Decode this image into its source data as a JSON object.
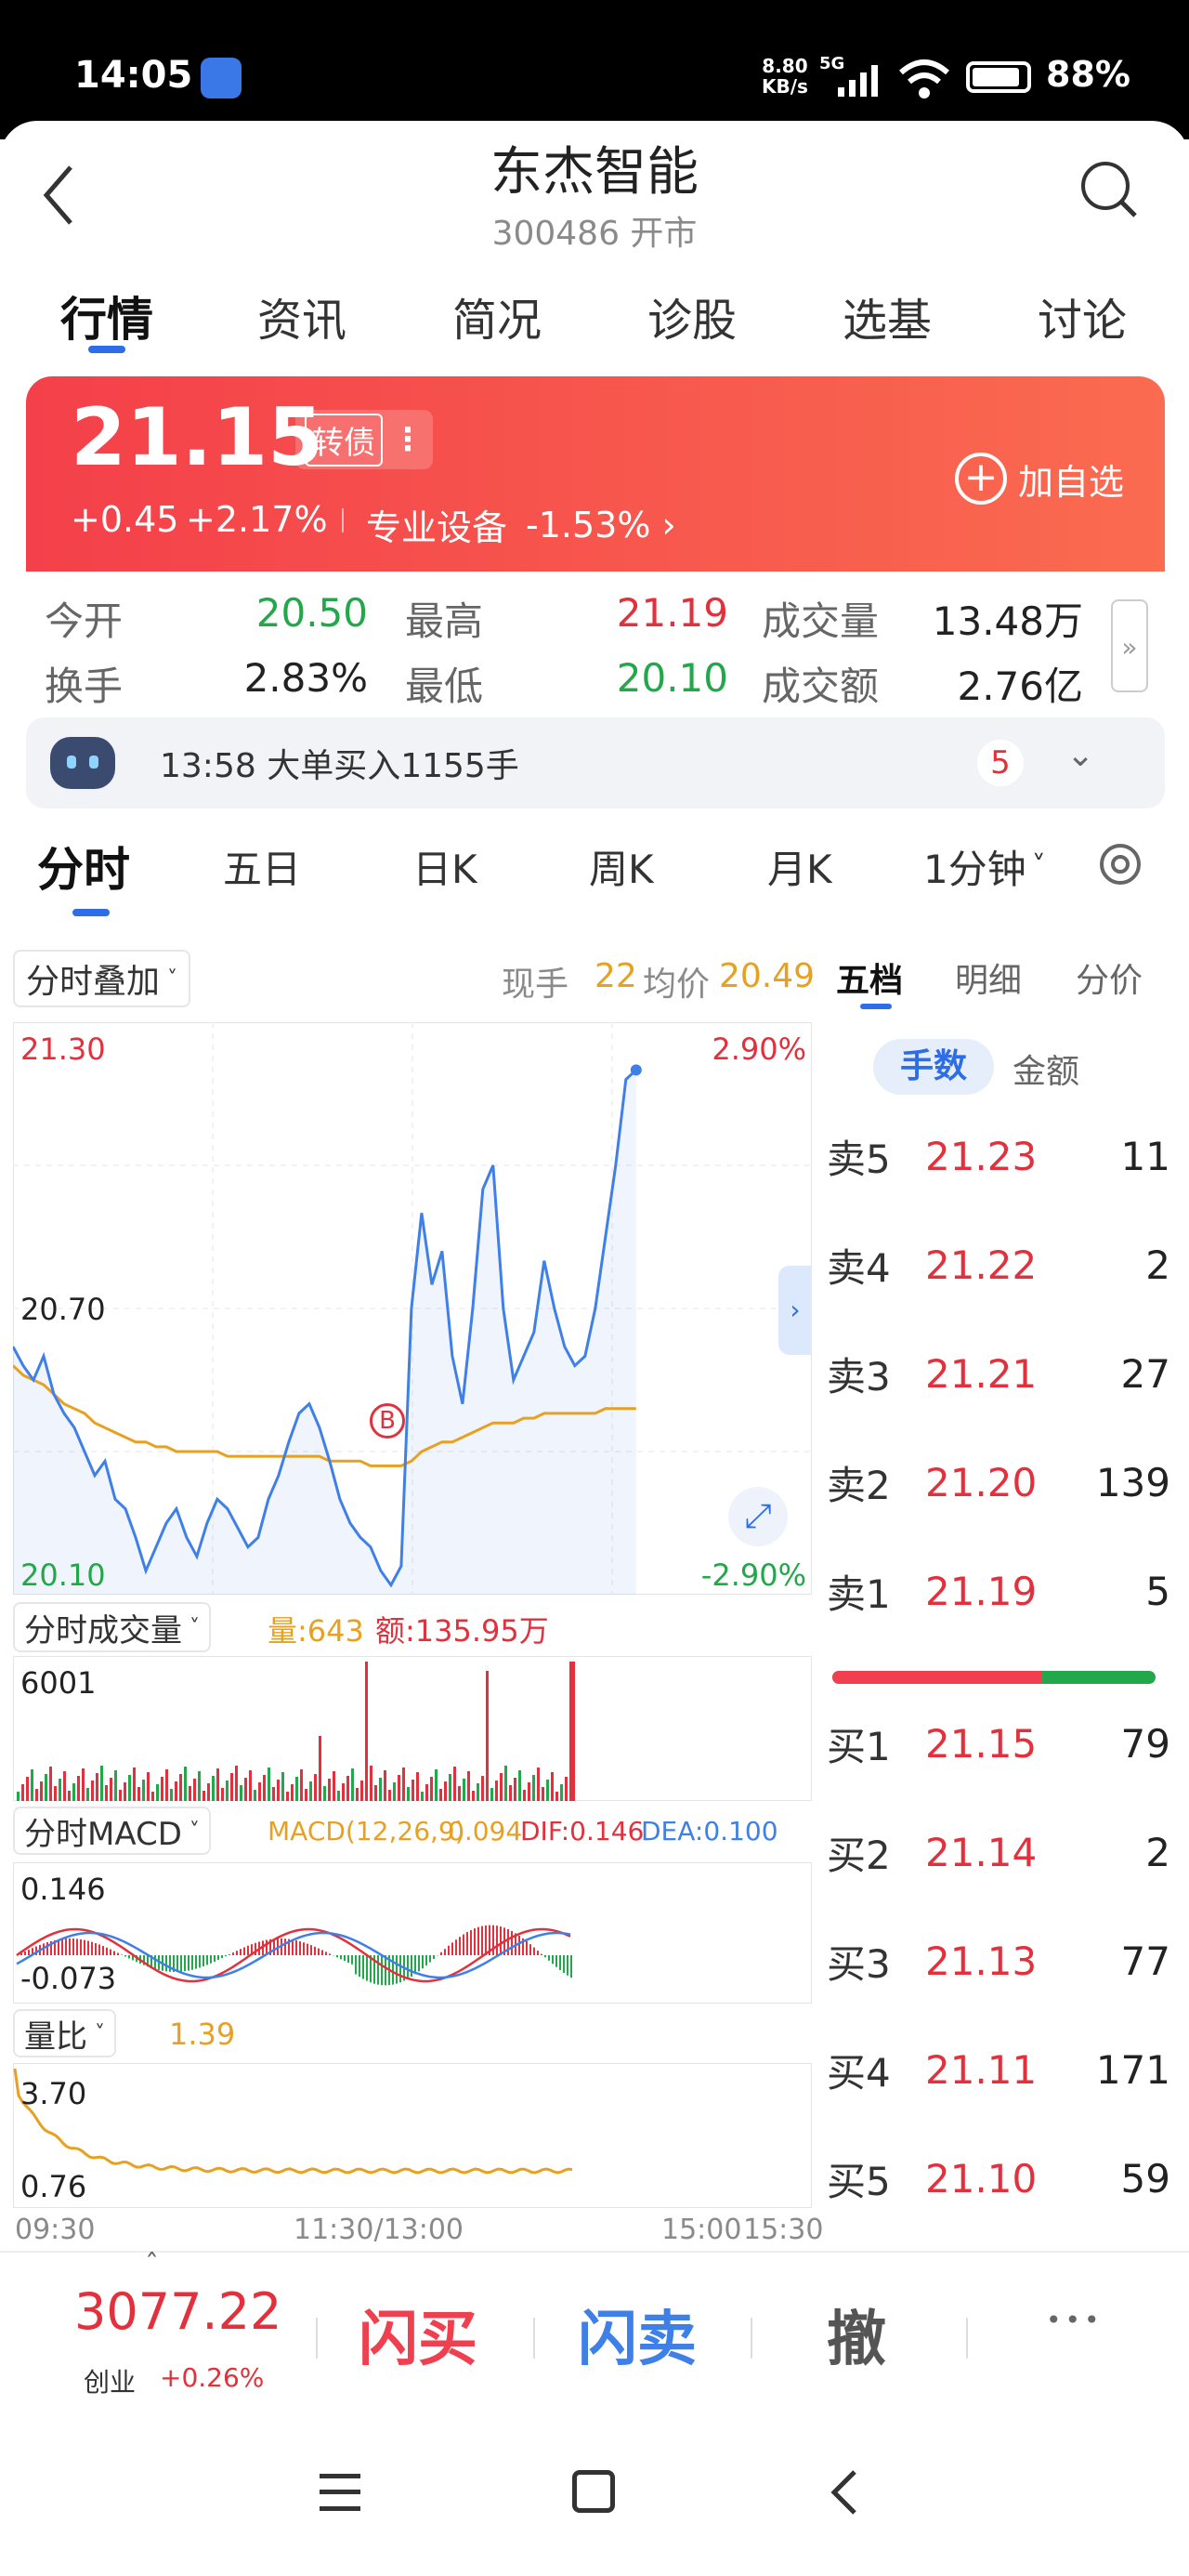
{
  "status_bar": {
    "time": "14:05",
    "net_speed_top": "8.80",
    "net_speed_bottom": "KB/s",
    "network": "5G",
    "battery": "88%"
  },
  "header": {
    "title": "东杰智能",
    "subtitle": "300486 开市"
  },
  "top_tabs": [
    {
      "label": "行情"
    },
    {
      "label": "资讯"
    },
    {
      "label": "简况"
    },
    {
      "label": "诊股"
    },
    {
      "label": "选基"
    },
    {
      "label": "讨论"
    }
  ],
  "price_card": {
    "price": "21.15",
    "tag": "转债",
    "change": "+0.45",
    "change_pct": "+2.17%",
    "sector": "专业设备",
    "sector_pct": "-1.53%",
    "add_watch": "加自选"
  },
  "stats": [
    {
      "label": "今开",
      "value": "20.50"
    },
    {
      "label": "最高",
      "value": "21.19"
    },
    {
      "label": "成交量",
      "value": "13.48万"
    },
    {
      "label": "换手",
      "value": "2.83%"
    },
    {
      "label": "最低",
      "value": "20.10"
    },
    {
      "label": "成交额",
      "value": "2.76亿"
    }
  ],
  "notice": {
    "text": "13:58 大单买入1155手",
    "count": "5"
  },
  "chart_tabs": [
    {
      "label": "分时"
    },
    {
      "label": "五日"
    },
    {
      "label": "日K"
    },
    {
      "label": "周K"
    },
    {
      "label": "月K"
    },
    {
      "label": "1分钟"
    }
  ],
  "intraday": {
    "overlay_btn": "分时叠加",
    "now_label": "现手",
    "now_value": "22",
    "avg_label": "均价",
    "avg_value": "20.49",
    "y_top": "21.30",
    "y_mid": "20.70",
    "y_bottom": "20.10",
    "pct_top": "2.90%",
    "pct_bottom": "-2.90%",
    "marker": "B",
    "volume_btn": "分时成交量",
    "volume_text": "量:643",
    "amount_text": "额:135.95万",
    "volume_max": "6001",
    "macd_btn": "分时MACD",
    "macd_params": "MACD(12,26,9)",
    "macd_value": "0.094",
    "dif_text": "DIF:0.146",
    "dea_text": "DEA:0.100",
    "macd_top": "0.146",
    "macd_bottom": "-0.073",
    "ratio_btn": "量比",
    "ratio_value": "1.39",
    "ratio_top": "3.70",
    "ratio_bottom": "0.76",
    "x_start": "09:30",
    "x_mid": "11:30/13:00",
    "x_end1": "15:00",
    "x_end2": "15:30"
  },
  "chart_data": {
    "type": "line",
    "title": "",
    "ylim": [
      20.1,
      21.3
    ],
    "price": [
      20.62,
      20.58,
      20.55,
      20.6,
      20.52,
      20.48,
      20.45,
      20.4,
      20.35,
      20.38,
      20.3,
      20.28,
      20.22,
      20.15,
      20.2,
      20.25,
      20.28,
      20.22,
      20.18,
      20.25,
      20.3,
      20.28,
      20.24,
      20.2,
      20.22,
      20.3,
      20.35,
      20.42,
      20.48,
      20.5,
      20.45,
      20.38,
      20.3,
      20.25,
      20.22,
      20.2,
      20.15,
      20.12,
      20.16,
      20.7,
      20.9,
      20.75,
      20.82,
      20.6,
      20.5,
      20.7,
      20.95,
      21.0,
      20.7,
      20.55,
      20.6,
      20.65,
      20.8,
      20.7,
      20.62,
      20.58,
      20.6,
      20.7,
      20.85,
      21.0,
      21.18,
      21.2
    ],
    "avg": [
      20.58,
      20.56,
      20.55,
      20.54,
      20.52,
      20.5,
      20.49,
      20.48,
      20.46,
      20.45,
      20.44,
      20.43,
      20.42,
      20.42,
      20.41,
      20.41,
      20.4,
      20.4,
      20.4,
      20.4,
      20.4,
      20.39,
      20.39,
      20.39,
      20.39,
      20.39,
      20.39,
      20.39,
      20.39,
      20.39,
      20.39,
      20.38,
      20.38,
      20.38,
      20.38,
      20.37,
      20.37,
      20.37,
      20.37,
      20.38,
      20.4,
      20.41,
      20.42,
      20.42,
      20.43,
      20.44,
      20.45,
      20.46,
      20.46,
      20.46,
      20.47,
      20.47,
      20.48,
      20.48,
      20.48,
      20.48,
      20.48,
      20.48,
      20.49,
      20.49,
      20.49,
      20.49
    ]
  },
  "depth_tabs": [
    {
      "label": "五档"
    },
    {
      "label": "明细"
    },
    {
      "label": "分价"
    }
  ],
  "depth_mode": {
    "a": "手数",
    "b": "金额"
  },
  "asks": [
    {
      "label": "卖5",
      "price": "21.23",
      "qty": "11"
    },
    {
      "label": "卖4",
      "price": "21.22",
      "qty": "2"
    },
    {
      "label": "卖3",
      "price": "21.21",
      "qty": "27"
    },
    {
      "label": "卖2",
      "price": "21.20",
      "qty": "139"
    },
    {
      "label": "卖1",
      "price": "21.19",
      "qty": "5"
    }
  ],
  "bids": [
    {
      "label": "买1",
      "price": "21.15",
      "qty": "79"
    },
    {
      "label": "买2",
      "price": "21.14",
      "qty": "2"
    },
    {
      "label": "买3",
      "price": "21.13",
      "qty": "77"
    },
    {
      "label": "买4",
      "price": "21.11",
      "qty": "171"
    },
    {
      "label": "买5",
      "price": "21.10",
      "qty": "59"
    }
  ],
  "buy_ratio": 0.65,
  "bottom_bar": {
    "index_value": "3077.22",
    "index_name": "创业",
    "index_pct": "+0.26%",
    "flash_buy": "闪买",
    "flash_sell": "闪卖",
    "cancel": "撤",
    "more": "•••"
  },
  "colors": {
    "red": "#e2313c",
    "green": "#22a84a",
    "blue": "#3f7fe8",
    "orange": "#e8a021"
  }
}
